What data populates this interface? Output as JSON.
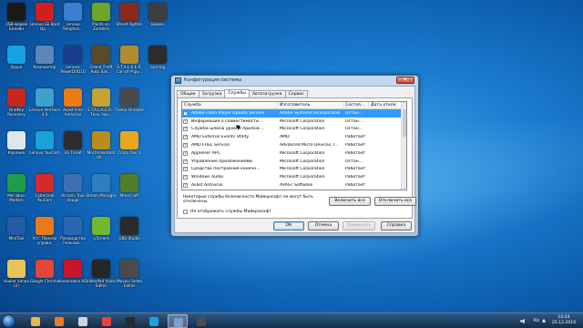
{
  "desktop": {
    "icons": [
      {
        "label": "USB-модем Билайн",
        "name": "usb-modem-beeline",
        "color": "#1a1a1a",
        "col": 0,
        "row": 0
      },
      {
        "label": "Lenovo EE Boot Op...",
        "name": "lenovo-ee-boot",
        "color": "#d11f1f",
        "col": 1,
        "row": 0
      },
      {
        "label": "Lenovo Telephon...",
        "name": "lenovo-telephony",
        "color": "#3a7fd0",
        "col": 2,
        "row": 0
      },
      {
        "label": "Plants vs. Zombies",
        "name": "plants-vs-zombies",
        "color": "#6da62b",
        "col": 3,
        "row": 0
      },
      {
        "label": "Street Fighter",
        "name": "street-fighter",
        "color": "#8b2a18",
        "col": 4,
        "row": 0
      },
      {
        "label": "Видео",
        "name": "video",
        "color": "#3e3e3e",
        "col": 5,
        "row": 0
      },
      {
        "label": "Skype",
        "name": "skype",
        "color": "#14a3e0",
        "col": 0,
        "row": 1
      },
      {
        "label": "Компьютер",
        "name": "computer",
        "color": "#5b86b8",
        "col": 1,
        "row": 1
      },
      {
        "label": "Lenovo PowerDVD10",
        "name": "powerdvd",
        "color": "#1c3e8a",
        "col": 2,
        "row": 1
      },
      {
        "label": "Grand Theft Auto San...",
        "name": "gta-san-andreas",
        "color": "#5a4a2a",
        "col": 3,
        "row": 1
      },
      {
        "label": "S.T.A.L.K.E.R. Call of Pripy...",
        "name": "stalker-cop",
        "color": "#b38a2e",
        "col": 4,
        "row": 1
      },
      {
        "label": "Gaming",
        "name": "gaming",
        "color": "#2c2c2c",
        "col": 5,
        "row": 1
      },
      {
        "label": "OneKey Recovery",
        "name": "onekey-recovery",
        "color": "#c8271f",
        "col": 0,
        "row": 2
      },
      {
        "label": "Lenovo VeriFace 4.0",
        "name": "veriface",
        "color": "#3fa0c9",
        "col": 1,
        "row": 2
      },
      {
        "label": "Avast Free Antivirus",
        "name": "avast",
        "color": "#ee7a12",
        "col": 2,
        "row": 2
      },
      {
        "label": "S.T.A.L.K.E.R. - Тень Чер...",
        "name": "stalker-shadow",
        "color": "#c7a131",
        "col": 3,
        "row": 2
      },
      {
        "label": "Танки Онлайн",
        "name": "tanki-online",
        "color": "#4a4a4a",
        "col": 4,
        "row": 2
      },
      {
        "label": "Корзина",
        "name": "recycle-bin",
        "color": "#dfe6ee",
        "col": 0,
        "row": 3
      },
      {
        "label": "Lenovo YouCam",
        "name": "youcam",
        "color": "#19a2d6",
        "col": 1,
        "row": 3
      },
      {
        "label": "3G Ticket",
        "name": "3g-ticket",
        "color": "#2d2d2d",
        "col": 2,
        "row": 3
      },
      {
        "label": "Mortal Kombat Ult...",
        "name": "mortal-kombat",
        "color": "#b88d18",
        "col": 3,
        "row": 3
      },
      {
        "label": "Crazy Taxi 3",
        "name": "crazy-taxi",
        "color": "#e9a620",
        "col": 4,
        "row": 3
      },
      {
        "label": "Мегафон Modem",
        "name": "megafon-modem",
        "color": "#1f9d4b",
        "col": 0,
        "row": 4
      },
      {
        "label": "CyberLink YouCam",
        "name": "cyberlink-youcam",
        "color": "#d52a2a",
        "col": 1,
        "row": 4
      },
      {
        "label": "Acronis True Image",
        "name": "acronis",
        "color": "#3d6fb1",
        "col": 2,
        "row": 4
      },
      {
        "label": "Steam Manager",
        "name": "steam-manager",
        "color": "#2f7fbf",
        "col": 3,
        "row": 4
      },
      {
        "label": "MineCraft",
        "name": "minecraft",
        "color": "#4f7d2a",
        "col": 4,
        "row": 4
      },
      {
        "label": "MiniTool",
        "name": "minitool",
        "color": "#245aa5",
        "col": 0,
        "row": 5
      },
      {
        "label": "Уст. Панели управл.",
        "name": "control-panel-setup",
        "color": "#e87a1a",
        "col": 1,
        "row": 5
      },
      {
        "label": "Руководство пользов...",
        "name": "user-guide",
        "color": "#2b66b0",
        "col": 2,
        "row": 5
      },
      {
        "label": "uTorrent",
        "name": "utorrent",
        "color": "#6fb82f",
        "col": 3,
        "row": 5
      },
      {
        "label": "OBS Studio",
        "name": "obs-studio",
        "color": "#2a2a2a",
        "col": 4,
        "row": 5
      },
      {
        "label": "Новая папка (2)",
        "name": "new-folder-2",
        "color": "#e8c35a",
        "col": 0,
        "row": 6
      },
      {
        "label": "Google Chrome",
        "name": "google-chrome",
        "color": "#e4463a",
        "col": 1,
        "row": 6
      },
      {
        "label": "Кинопоиск HD",
        "name": "kinopoisk",
        "color": "#c9152a",
        "col": 2,
        "row": 6
      },
      {
        "label": "VideoPad Video Editor",
        "name": "videopad",
        "color": "#262626",
        "col": 3,
        "row": 6
      },
      {
        "label": "Movavi Video Editor",
        "name": "movavi",
        "color": "#4b4b4b",
        "col": 4,
        "row": 6
      }
    ]
  },
  "window": {
    "title": "Конфигурация системы",
    "close_glyph": "✕",
    "tabs": [
      "Общие",
      "Загрузка",
      "Службы",
      "Автозагрузка",
      "Сервис"
    ],
    "active_tab": 2,
    "columns": [
      "Служба",
      "Изготовитель",
      "Состоя...",
      "Дата отключе..."
    ],
    "rows": [
      {
        "service": "Adobe Flash Player Update Service",
        "maker": "Adobe Systems Incorporated",
        "state": "Остан...",
        "checked": true,
        "selected": true
      },
      {
        "service": "Информация о совместимости ...",
        "maker": "Microsoft Corporation",
        "state": "Остан...",
        "checked": true,
        "selected": false
      },
      {
        "service": "Служба шлюза уровня прилож...",
        "maker": "Microsoft Corporation",
        "state": "Остан...",
        "checked": true,
        "selected": false
      },
      {
        "service": "AMD External Events Utility",
        "maker": "AMD",
        "state": "Работает",
        "checked": true,
        "selected": false
      },
      {
        "service": "AMD FUEL Service",
        "maker": "Advanced Micro Devices, I...",
        "state": "Работает",
        "checked": true,
        "selected": false
      },
      {
        "service": "AppleHer APC",
        "maker": "Microsoft Corporation",
        "state": "Работает",
        "checked": true,
        "selected": false
      },
      {
        "service": "Управление приложениями",
        "maker": "Microsoft Corporation",
        "state": "Остан...",
        "checked": true,
        "selected": false
      },
      {
        "service": "Средство построения конечн...",
        "maker": "Microsoft Corporation",
        "state": "Работает",
        "checked": true,
        "selected": false
      },
      {
        "service": "Windows Audio",
        "maker": "Microsoft Corporation",
        "state": "Работает",
        "checked": true,
        "selected": false
      },
      {
        "service": "Avast Antivirus",
        "maker": "AVAST Software",
        "state": "Работает",
        "checked": true,
        "selected": false
      },
      {
        "service": "Установщик ActiveX (AxInstSV)",
        "maker": "Microsoft Corporation",
        "state": "Остан...",
        "checked": true,
        "selected": false
      }
    ],
    "note": "Некоторые службы безопасности Майкрософт не могут быть отключены.",
    "enable_all": "Включить все",
    "disable_all": "Отключить все",
    "hide_ms_label": "Не отображать службы Майкрософт",
    "ok": "ОК",
    "cancel": "Отмена",
    "apply": "Применить",
    "help": "Справка"
  },
  "taskbar": {
    "items": [
      {
        "name": "explorer-taskbar-icon",
        "color": "#e6b94a",
        "active": false
      },
      {
        "name": "media-player-taskbar-icon",
        "color": "#f07a1d",
        "active": false
      },
      {
        "name": "windows-store-taskbar-icon",
        "color": "#cfd6df",
        "active": false
      },
      {
        "name": "chrome-taskbar-icon",
        "color": "#e4463a",
        "active": false
      },
      {
        "name": "obs-taskbar-icon",
        "color": "#2a2a2a",
        "active": false
      },
      {
        "name": "skype-taskbar-icon",
        "color": "#14a3e0",
        "active": false
      },
      {
        "name": "msconfig-taskbar-icon",
        "color": "#7c9fcb",
        "active": true
      },
      {
        "name": "unknown-app-taskbar-icon",
        "color": "#4d4d4d",
        "active": false
      }
    ],
    "lang": "RU",
    "tray_arrow": "▲",
    "time": "14:24",
    "date": "25.12.2016"
  }
}
